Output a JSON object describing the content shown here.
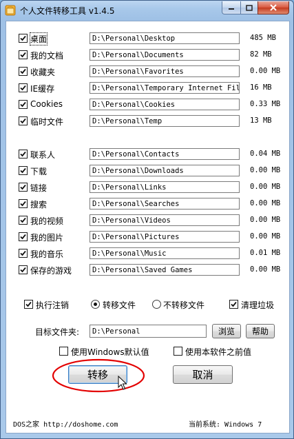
{
  "window": {
    "title": "个人文件转移工具 v1.4.5",
    "colors": {
      "title_bar": "#a8c8ea",
      "close_button": "#c43b1f",
      "highlight_circle": "#e30000"
    }
  },
  "folders_group1": [
    {
      "label": "桌面",
      "path": "D:\\Personal\\Desktop",
      "size": "485 MB",
      "checked": true
    },
    {
      "label": "我的文档",
      "path": "D:\\Personal\\Documents",
      "size": "82 MB",
      "checked": true
    },
    {
      "label": "收藏夹",
      "path": "D:\\Personal\\Favorites",
      "size": "0.00 MB",
      "checked": true
    },
    {
      "label": "IE缓存",
      "path": "D:\\Personal\\Temporary Internet Files",
      "size": "16 MB",
      "checked": true
    },
    {
      "label": "Cookies",
      "path": "D:\\Personal\\Cookies",
      "size": "0.33 MB",
      "checked": true
    },
    {
      "label": "临时文件",
      "path": "D:\\Personal\\Temp",
      "size": "13 MB",
      "checked": true
    }
  ],
  "folders_group2": [
    {
      "label": "联系人",
      "path": "D:\\Personal\\Contacts",
      "size": "0.04 MB",
      "checked": true
    },
    {
      "label": "下载",
      "path": "D:\\Personal\\Downloads",
      "size": "0.00 MB",
      "checked": true
    },
    {
      "label": "链接",
      "path": "D:\\Personal\\Links",
      "size": "0.00 MB",
      "checked": true
    },
    {
      "label": "搜索",
      "path": "D:\\Personal\\Searches",
      "size": "0.00 MB",
      "checked": true
    },
    {
      "label": "我的视频",
      "path": "D:\\Personal\\Videos",
      "size": "0.00 MB",
      "checked": true
    },
    {
      "label": "我的图片",
      "path": "D:\\Personal\\Pictures",
      "size": "0.00 MB",
      "checked": true
    },
    {
      "label": "我的音乐",
      "path": "D:\\Personal\\Music",
      "size": "0.01 MB",
      "checked": true
    },
    {
      "label": "保存的游戏",
      "path": "D:\\Personal\\Saved Games",
      "size": "0.00 MB",
      "checked": true
    }
  ],
  "options": {
    "execute_logoff": {
      "label": "执行注销",
      "checked": true
    },
    "mode_transfer": {
      "label": "转移文件",
      "selected": true
    },
    "mode_no_transfer": {
      "label": "不转移文件",
      "selected": false
    },
    "cleanup": {
      "label": "清理垃圾",
      "checked": true
    }
  },
  "target": {
    "label": "目标文件夹:",
    "path": "D:\\Personal",
    "browse_label": "浏览",
    "help_label": "帮助"
  },
  "defaults": {
    "use_windows_default": {
      "label": "使用Windows默认值",
      "checked": false
    },
    "use_previous": {
      "label": "使用本软件之前值",
      "checked": false
    }
  },
  "actions": {
    "transfer_label": "转移",
    "cancel_label": "取消"
  },
  "footer": {
    "site": "DOS之家 http://doshome.com",
    "system": "当前系统: Windows 7"
  }
}
